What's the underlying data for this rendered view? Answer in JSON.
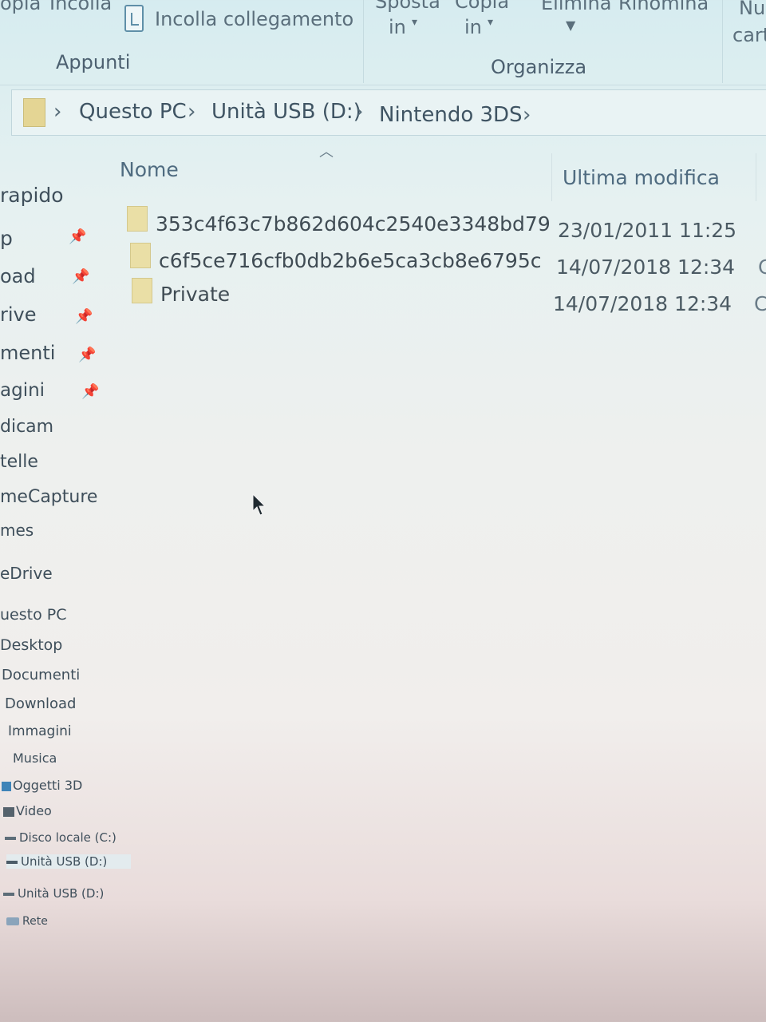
{
  "ribbon": {
    "copy_label": "opia",
    "paste_label": "Incolla",
    "paste_link_label": "Incolla collegamento",
    "clipboard_group": "Appunti",
    "move_to_line1": "Sposta",
    "move_to_line2": "in",
    "copy_to_line1": "Copia",
    "copy_to_line2": "in",
    "delete_label": "Elimina",
    "rename_label": "Rinomina",
    "new_folder_line1": "Nu",
    "new_folder_line2": "cart",
    "organize_group": "Organizza"
  },
  "address": {
    "crumbs": [
      "Questo PC",
      "Unità USB (D:)",
      "Nintendo 3DS"
    ]
  },
  "sidebar": {
    "items": [
      {
        "label": "rapido"
      },
      {
        "label": "p"
      },
      {
        "label": "oad"
      },
      {
        "label": "rive"
      },
      {
        "label": "menti"
      },
      {
        "label": "agini"
      },
      {
        "label": "dicam"
      },
      {
        "label": "telle"
      },
      {
        "label": "meCapture"
      },
      {
        "label": "mes"
      },
      {
        "label": "eDrive"
      },
      {
        "label": "uesto PC"
      },
      {
        "label": "Desktop"
      },
      {
        "label": "Documenti"
      },
      {
        "label": "Download"
      },
      {
        "label": "Immagini"
      },
      {
        "label": "Musica"
      },
      {
        "label": "Oggetti 3D"
      },
      {
        "label": "Video"
      },
      {
        "label": "Disco locale (C:)"
      },
      {
        "label": "Unità USB (D:)"
      },
      {
        "label": "Unità USB (D:)"
      },
      {
        "label": "Rete"
      }
    ]
  },
  "columns": {
    "name": "Nome",
    "modified": "Ultima modifica"
  },
  "files": [
    {
      "name": "353c4f63c7b862d604c2540e3348bd79",
      "modified": "23/01/2011 11:25",
      "extra": ""
    },
    {
      "name": "c6f5ce716cfb0db2b6e5ca3cb8e6795c",
      "modified": "14/07/2018 12:34",
      "extra": "C"
    },
    {
      "name": "Private",
      "modified": "14/07/2018 12:34",
      "extra": "C"
    }
  ]
}
